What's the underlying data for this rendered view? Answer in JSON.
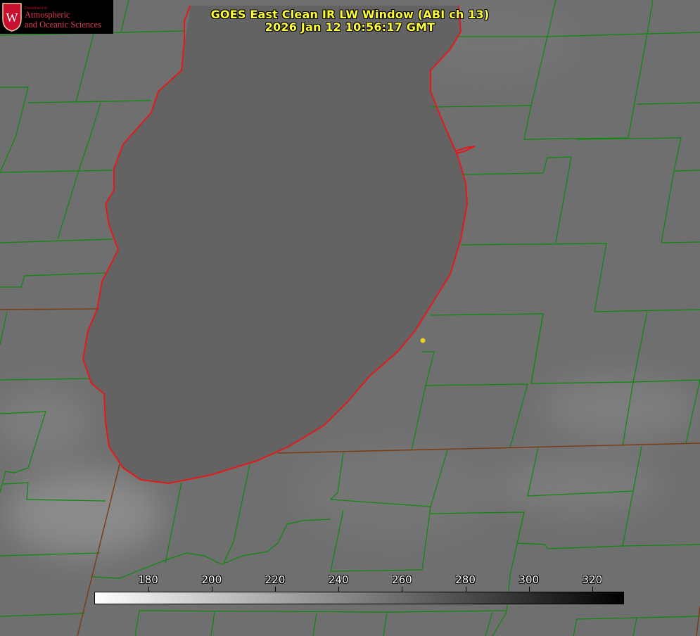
{
  "header": {
    "title_line1": "GOES East Clean IR LW Window (ABI ch 13)",
    "title_line2": "2026 Jan 12 10:56:17 GMT"
  },
  "logo": {
    "department": "Department of",
    "line1": "Atmospheric",
    "line2": "and Oceanic Sciences",
    "seal_letter": "W"
  },
  "colorbar": {
    "ticks": [
      "180",
      "200",
      "220",
      "240",
      "260",
      "280",
      "300",
      "320"
    ],
    "min": 163.0,
    "max": 330.0,
    "low_color": "#ffffff",
    "high_color": "#000000"
  },
  "colors": {
    "title": "#ffff33",
    "county_lines": "#0a8a0a",
    "coastline": "#e31a1c",
    "marker": "#e8d020",
    "lake": "#626262",
    "land": "#6f6f6f"
  }
}
